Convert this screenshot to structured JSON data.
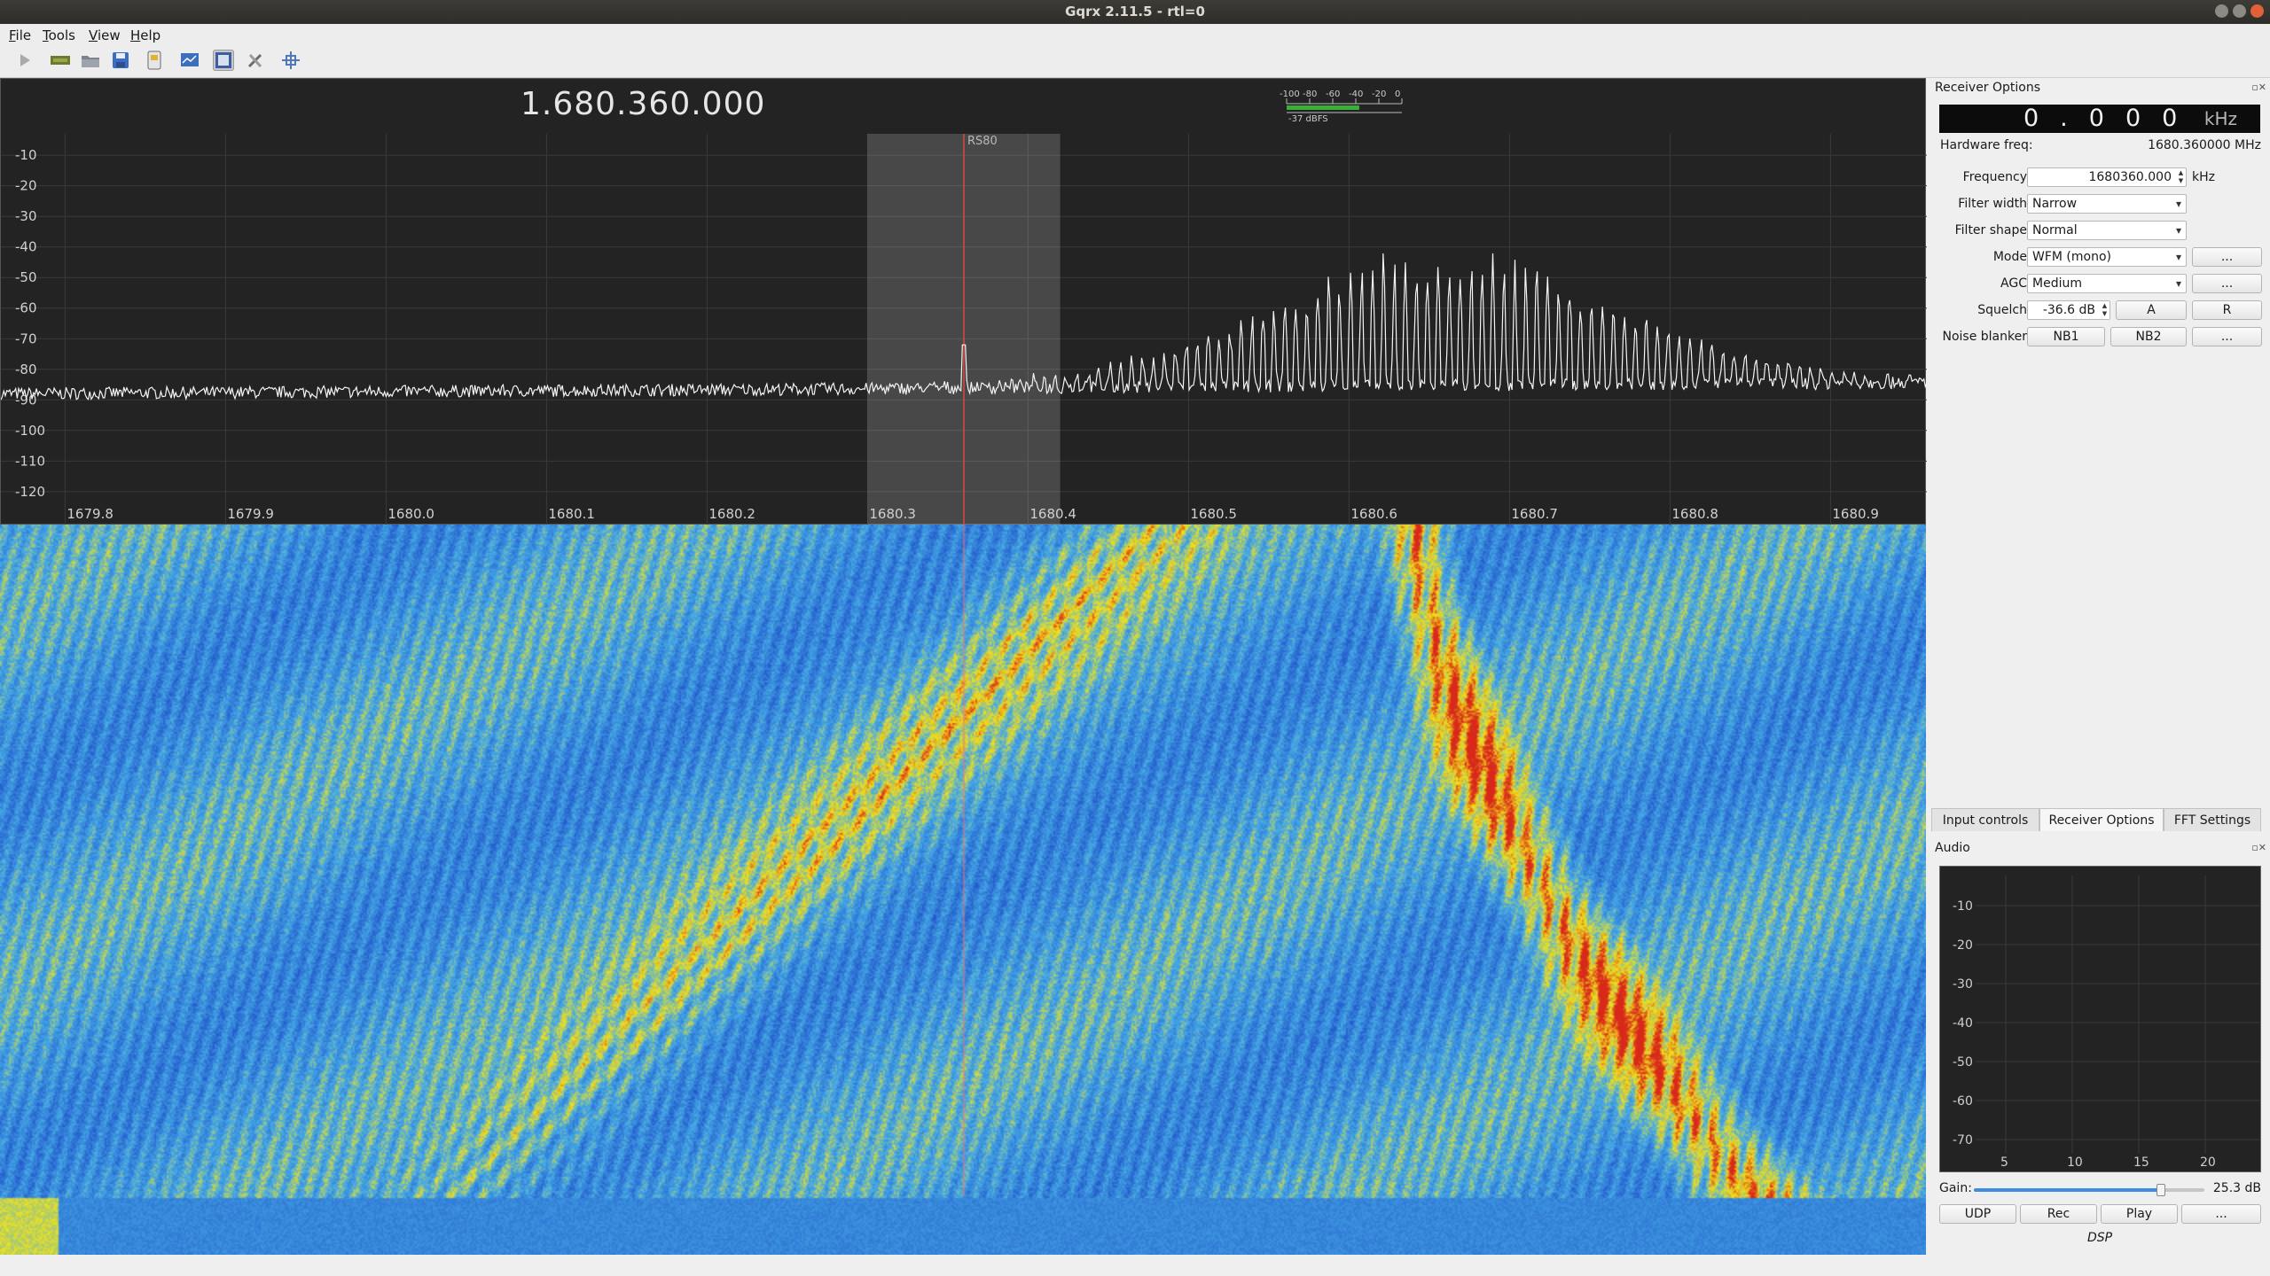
{
  "window": {
    "title": "Gqrx 2.11.5 - rtl=0"
  },
  "menu": [
    "File",
    "Tools",
    "View",
    "Help"
  ],
  "toolbar": {
    "icons": [
      "play-icon",
      "device-config-icon",
      "open-icon",
      "save-icon",
      "remote-control-icon",
      "screenshot-icon",
      "dsp-toggle-icon",
      "tools-icon",
      "autoscale-icon"
    ]
  },
  "plot": {
    "frequency_readout": "1.680.360.000",
    "filter_label": "RS80",
    "meter_ticks": [
      "-100",
      "-80",
      "-60",
      "-40",
      "-20",
      "0"
    ],
    "meter_value": "-37 dBFS",
    "meter_level": -37
  },
  "chart_data": {
    "type": "line",
    "xlabel": "",
    "ylabel": "",
    "x_ticks": [
      "1679.8",
      "1679.9",
      "1680.0",
      "1680.1",
      "1680.2",
      "1680.3",
      "1680.4",
      "1680.5",
      "1680.6",
      "1680.7",
      "1680.8",
      "1680.9"
    ],
    "x_tick_values": [
      1679.8,
      1679.9,
      1680.0,
      1680.1,
      1680.2,
      1680.3,
      1680.4,
      1680.5,
      1680.6,
      1680.7,
      1680.8,
      1680.9
    ],
    "y_ticks": [
      "-10",
      "-20",
      "-30",
      "-40",
      "-50",
      "-60",
      "-70",
      "-80",
      "-90",
      "-100",
      "-110",
      "-120"
    ],
    "y_tick_values": [
      -10,
      -20,
      -30,
      -40,
      -50,
      -60,
      -70,
      -80,
      -90,
      -100,
      -110,
      -120
    ],
    "xlim": [
      1679.76,
      1680.96
    ],
    "ylim": [
      -127,
      -3
    ],
    "filter_band": [
      1680.3,
      1680.42
    ],
    "tuned_freq": 1680.36,
    "noise_floor": -88,
    "signal_center": 1680.66,
    "signal_peak": -42,
    "spur_at": 1680.36,
    "spur_level": -72,
    "grid": true
  },
  "receiver": {
    "panel_title": "Receiver Options",
    "lcd_digits": "0.000",
    "lcd_unit": "kHz",
    "hw_freq_label": "Hardware freq:",
    "hw_freq_value": "1680.360000 MHz",
    "frequency_label": "Frequency",
    "frequency_value": "1680360.000",
    "frequency_unit": "kHz",
    "filter_width_label": "Filter width",
    "filter_width_value": "Narrow",
    "filter_shape_label": "Filter shape",
    "filter_shape_value": "Normal",
    "mode_label": "Mode",
    "mode_value": "WFM (mono)",
    "agc_label": "AGC",
    "agc_value": "Medium",
    "squelch_label": "Squelch",
    "squelch_value": "-36.6 dB",
    "noise_blanker_label": "Noise blanker",
    "more_label": "...",
    "a_label": "A",
    "r_label": "R",
    "nb1_label": "NB1",
    "nb2_label": "NB2"
  },
  "tabs": [
    "Input controls",
    "Receiver Options",
    "FFT Settings"
  ],
  "audio": {
    "panel_title": "Audio",
    "y_ticks": [
      "-10",
      "-20",
      "-30",
      "-40",
      "-50",
      "-60",
      "-70"
    ],
    "x_ticks": [
      "5",
      "10",
      "15",
      "20"
    ],
    "gain_label": "Gain:",
    "gain_value": "25.3 dB",
    "gain_fraction": 0.81,
    "buttons": [
      "UDP",
      "Rec",
      "Play",
      "..."
    ],
    "footer": "DSP"
  },
  "colors": {
    "trace": "#f4f4f4",
    "tuned_line": "#d9483f",
    "waterfall_low": "#1d5ac8",
    "waterfall_mid": "#f2e21a",
    "waterfall_high": "#d8281c"
  }
}
